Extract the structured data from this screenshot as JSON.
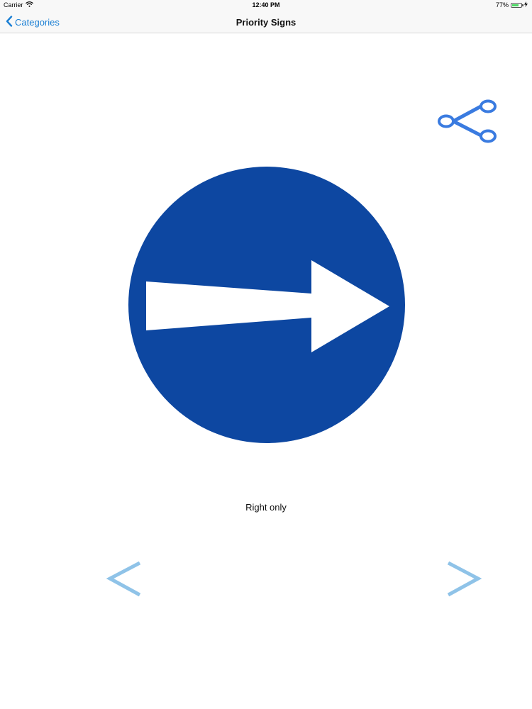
{
  "status_bar": {
    "carrier": "Carrier",
    "time": "12:40 PM",
    "battery_text": "77%",
    "battery_level": 0.77,
    "battery_color": "#4cd964"
  },
  "nav_bar": {
    "back_label": "Categories",
    "title": "Priority Signs",
    "accent_color": "#1a7fd4"
  },
  "sign": {
    "label": "Right only",
    "circle_color": "#0d47a1",
    "arrow_color": "#ffffff"
  },
  "icons": {
    "share": "share-icon",
    "prev": "chevron-left-icon",
    "next": "chevron-right-icon",
    "share_color": "#3a7be0",
    "arrow_nav_color": "#8fc3e8"
  }
}
